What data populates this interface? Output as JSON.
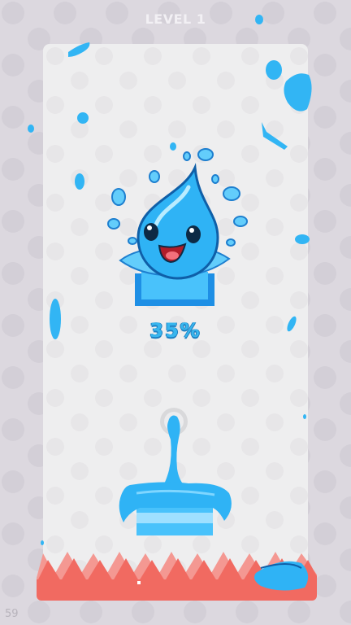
{
  "level": {
    "label": "LEVEL 1"
  },
  "progress": {
    "text": "35%",
    "value": 0.35
  },
  "fps": {
    "value": "59"
  },
  "colors": {
    "background": "#dcd8df",
    "card": "#eeeeef",
    "water": "#2fb3f5",
    "water_dark": "#1a8fe0",
    "spikes": "#f16a61",
    "spikes_light": "#f49892"
  },
  "icons": {
    "mascot": "water-drop-mascot-icon",
    "pen": "draw-origin-icon"
  }
}
